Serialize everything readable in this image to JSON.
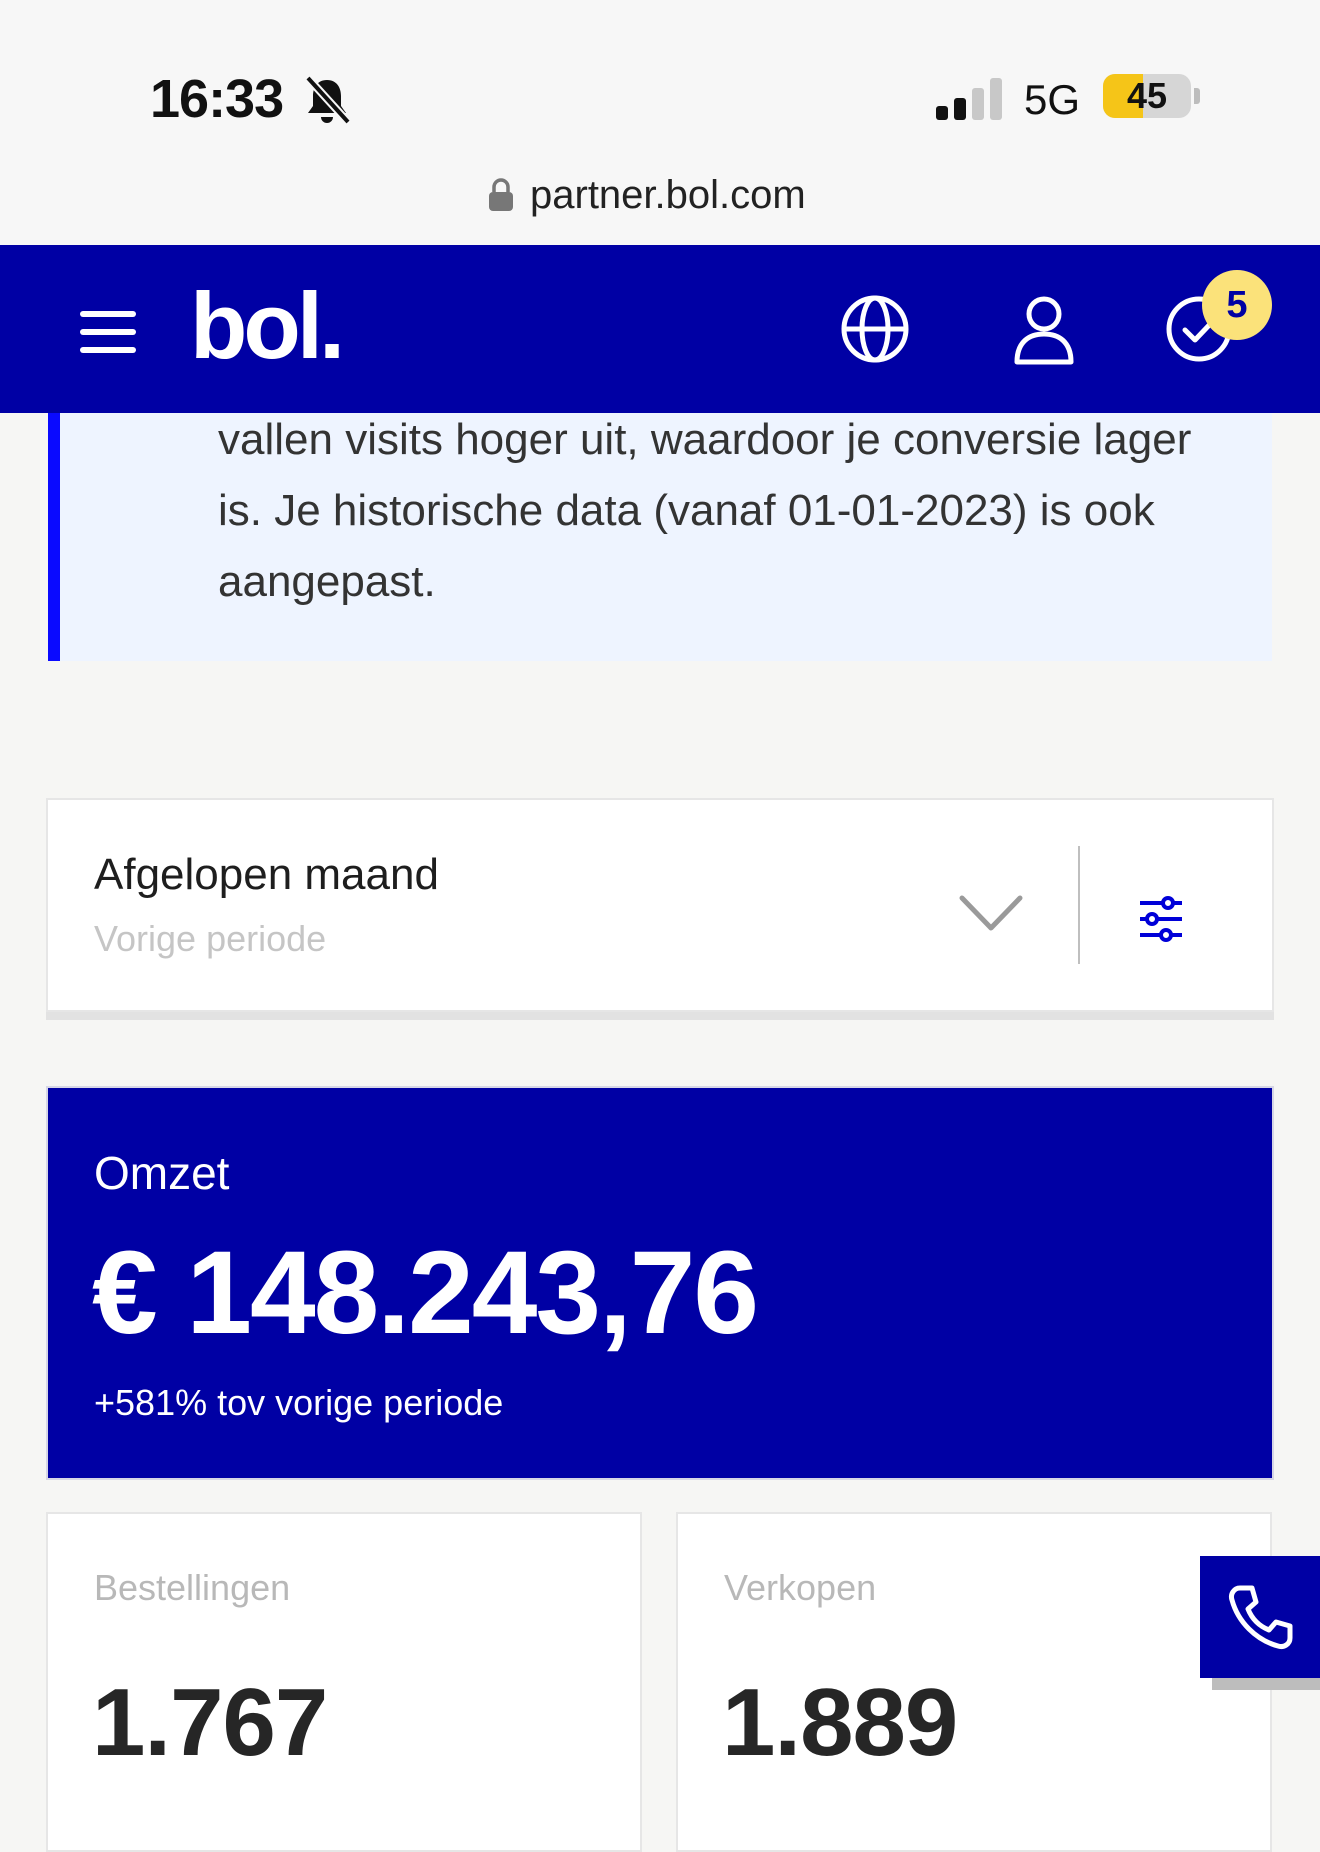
{
  "status_bar": {
    "time": "16:33",
    "network": "5G",
    "battery": "45",
    "battery_level": 0.45,
    "icons": [
      "bell-slash-icon",
      "signal-icon",
      "battery-icon"
    ]
  },
  "browser": {
    "url": "partner.bol.com",
    "icons": [
      "lock-icon"
    ]
  },
  "header": {
    "logo": "bol.",
    "notification_count": "5",
    "background": "#0000a4",
    "icons": [
      "menu-icon",
      "globe-icon",
      "user-icon",
      "check-circle-icon"
    ]
  },
  "info": {
    "text": "vallen visits hoger uit, waardoor je conversie lager is. Je historische data (vanaf 01-01-2023) is ook aangepast.",
    "accent": "#0a0aff"
  },
  "period": {
    "title": "Afgelopen maand",
    "subtitle": "Vorige periode",
    "icons": [
      "chevron-down-icon",
      "filter-icon"
    ]
  },
  "omzet": {
    "label": "Omzet",
    "value": "€ 148.243,76",
    "change": "+581% tov vorige periode"
  },
  "stats": [
    {
      "label": "Bestellingen",
      "value": "1.767"
    },
    {
      "label": "Verkopen",
      "value": "1.889"
    }
  ],
  "call": {
    "icon": "phone-icon"
  }
}
